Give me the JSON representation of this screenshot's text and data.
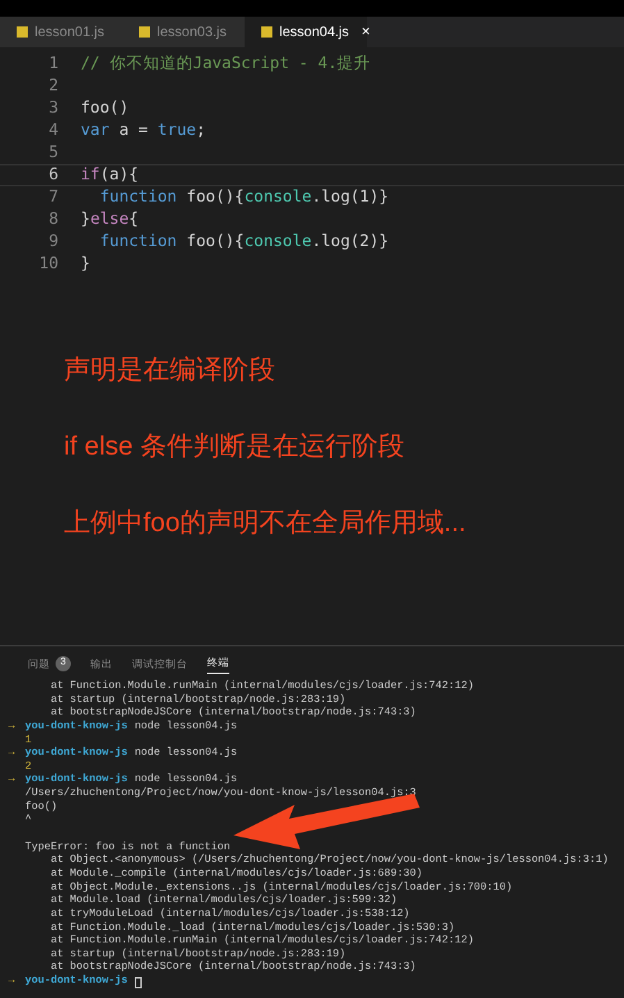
{
  "tabs": [
    {
      "label": "lesson01.js",
      "selected": false
    },
    {
      "label": "lesson03.js",
      "selected": false
    },
    {
      "label": "lesson04.js",
      "selected": true,
      "close": "×"
    }
  ],
  "code_lines": [
    {
      "number": "1",
      "current": false,
      "tokens": [
        {
          "text": "// 你不知道的JavaScript - 4.提升",
          "kind": "comment"
        }
      ]
    },
    {
      "number": "2",
      "current": false
    },
    {
      "number": "3",
      "current": false,
      "tokens": [
        {
          "text": "foo()",
          "kind": "plain"
        }
      ]
    },
    {
      "number": "4",
      "current": false,
      "tokens": [
        {
          "text": "var",
          "kind": "keyword"
        },
        {
          "text": " a = ",
          "kind": "plain"
        },
        {
          "text": "true",
          "kind": "keyword"
        },
        {
          "text": ";",
          "kind": "plain"
        }
      ]
    },
    {
      "number": "5",
      "current": false
    },
    {
      "number": "6",
      "current": true,
      "tokens": [
        {
          "text": "if",
          "kind": "control"
        },
        {
          "text": "(a){",
          "kind": "plain"
        }
      ]
    },
    {
      "number": "7",
      "current": false,
      "tokens": [
        {
          "text": "  function",
          "kind": "keyword"
        },
        {
          "text": " foo(){",
          "kind": "plain"
        },
        {
          "text": "console",
          "kind": "type"
        },
        {
          "text": ".log(1)}",
          "kind": "plain"
        }
      ]
    },
    {
      "number": "8",
      "current": false,
      "tokens": [
        {
          "text": "}",
          "kind": "plain"
        },
        {
          "text": "else",
          "kind": "control"
        },
        {
          "text": "{",
          "kind": "plain"
        }
      ]
    },
    {
      "number": "9",
      "current": false,
      "tokens": [
        {
          "text": "  function",
          "kind": "keyword"
        },
        {
          "text": " foo(){",
          "kind": "plain"
        },
        {
          "text": "console",
          "kind": "type"
        },
        {
          "text": ".log(2)}",
          "kind": "plain"
        }
      ]
    },
    {
      "number": "10",
      "current": false,
      "tokens": [
        {
          "text": "}",
          "kind": "plain"
        }
      ]
    }
  ],
  "annotations": [
    "声明是在编译阶段",
    "if else 条件判断是在运行阶段",
    "上例中foo的声明不在全局作用域..."
  ],
  "panel_tabs": [
    {
      "label": "问题",
      "badge": "3",
      "selected": false
    },
    {
      "label": "输出",
      "selected": false
    },
    {
      "label": "调试控制台",
      "selected": false
    },
    {
      "label": "终端",
      "selected": true
    }
  ],
  "terminal": [
    {
      "kind": "plain",
      "text": "    at Function.Module.runMain (internal/modules/cjs/loader.js:742:12)"
    },
    {
      "kind": "plain",
      "text": "    at startup (internal/bootstrap/node.js:283:19)"
    },
    {
      "kind": "plain",
      "text": "    at bootstrapNodeJSCore (internal/bootstrap/node.js:743:3)"
    },
    {
      "kind": "prompt",
      "arrow": "→",
      "dir": "you-dont-know-js",
      "text": "node lesson04.js"
    },
    {
      "kind": "output",
      "text": "1"
    },
    {
      "kind": "prompt",
      "arrow": "→",
      "dir": "you-dont-know-js",
      "text": "node lesson04.js"
    },
    {
      "kind": "output",
      "text": "2"
    },
    {
      "kind": "prompt",
      "arrow": "→",
      "dir": "you-dont-know-js",
      "text": "node lesson04.js"
    },
    {
      "kind": "plain",
      "text": "/Users/zhuchentong/Project/now/you-dont-know-js/lesson04.js:3"
    },
    {
      "kind": "plain",
      "text": "foo()"
    },
    {
      "kind": "plain",
      "text": "^"
    },
    {
      "kind": "blank"
    },
    {
      "kind": "plain",
      "text": "TypeError: foo is not a function"
    },
    {
      "kind": "plain",
      "text": "    at Object.<anonymous> (/Users/zhuchentong/Project/now/you-dont-know-js/lesson04.js:3:1)"
    },
    {
      "kind": "plain",
      "text": "    at Module._compile (internal/modules/cjs/loader.js:689:30)"
    },
    {
      "kind": "plain",
      "text": "    at Object.Module._extensions..js (internal/modules/cjs/loader.js:700:10)"
    },
    {
      "kind": "plain",
      "text": "    at Module.load (internal/modules/cjs/loader.js:599:32)"
    },
    {
      "kind": "plain",
      "text": "    at tryModuleLoad (internal/modules/cjs/loader.js:538:12)"
    },
    {
      "kind": "plain",
      "text": "    at Function.Module._load (internal/modules/cjs/loader.js:530:3)"
    },
    {
      "kind": "plain",
      "text": "    at Function.Module.runMain (internal/modules/cjs/loader.js:742:12)"
    },
    {
      "kind": "plain",
      "text": "    at startup (internal/bootstrap/node.js:283:19)"
    },
    {
      "kind": "plain",
      "text": "    at bootstrapNodeJSCore (internal/bootstrap/node.js:743:3)"
    },
    {
      "kind": "prompt",
      "arrow": "→",
      "dir": "you-dont-know-js",
      "cursor": true
    }
  ]
}
